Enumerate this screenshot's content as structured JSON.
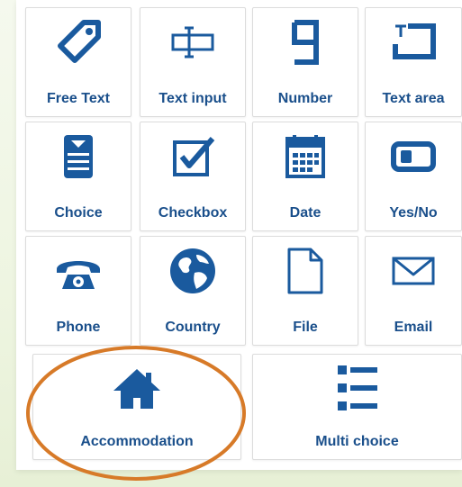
{
  "colors": {
    "icon": "#1a5a9e",
    "label": "#1a4f8b",
    "highlight": "#d77a28"
  },
  "tiles": [
    {
      "label": "Free Text",
      "icon": "tag-icon"
    },
    {
      "label": "Text input",
      "icon": "text-input-icon"
    },
    {
      "label": "Number",
      "icon": "number-icon"
    },
    {
      "label": "Text area",
      "icon": "text-area-icon"
    },
    {
      "label": "Choice",
      "icon": "choice-icon"
    },
    {
      "label": "Checkbox",
      "icon": "checkbox-icon"
    },
    {
      "label": "Date",
      "icon": "calendar-icon"
    },
    {
      "label": "Yes/No",
      "icon": "toggle-icon"
    },
    {
      "label": "Phone",
      "icon": "phone-icon"
    },
    {
      "label": "Country",
      "icon": "globe-icon"
    },
    {
      "label": "File",
      "icon": "file-icon"
    },
    {
      "label": "Email",
      "icon": "envelope-icon"
    },
    {
      "label": "Accommodation",
      "icon": "house-icon"
    },
    {
      "label": "Multi choice",
      "icon": "list-icon"
    }
  ]
}
